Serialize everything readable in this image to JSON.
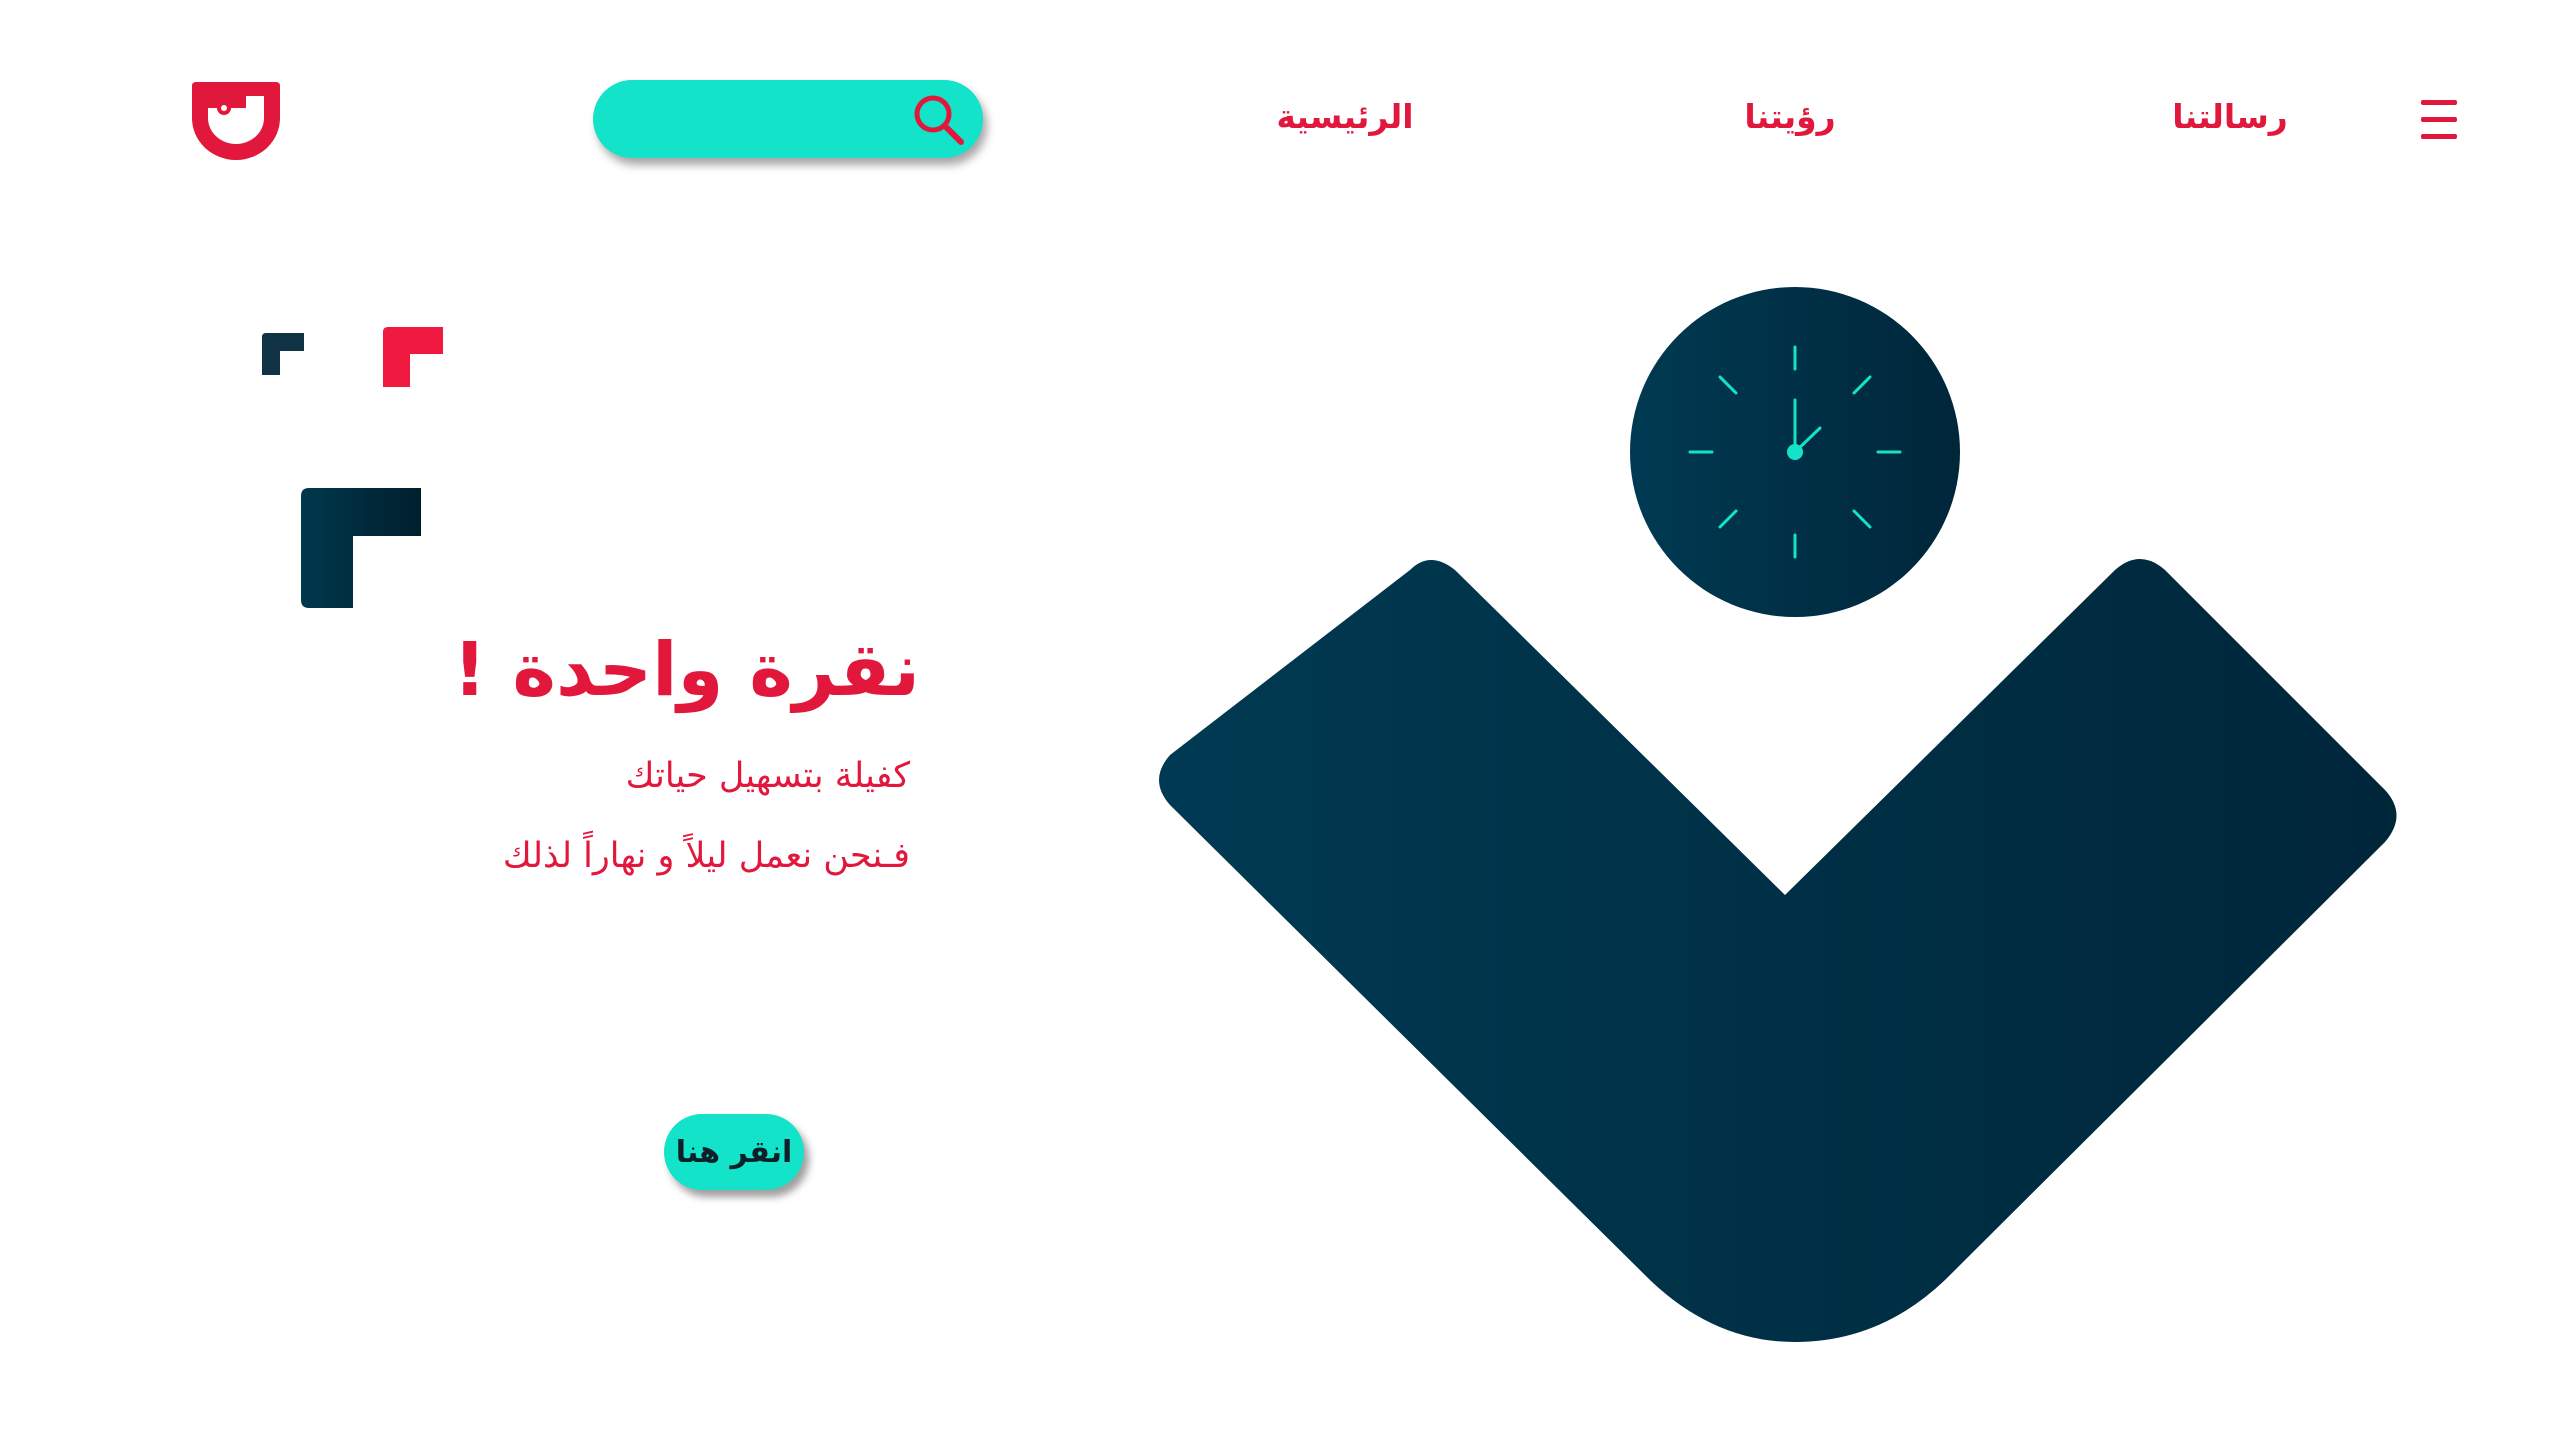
{
  "nav": {
    "home": "الرئيسية",
    "vision": "رؤيتنا",
    "mission": "رسالتنا"
  },
  "hero": {
    "title": "نقرة واحدة !",
    "line1": "كفيلة بتسهيل حياتك",
    "line2": "فـنحن نعمل ليلاً و نهاراً لذلك",
    "cta_label": "انقر هنا"
  },
  "colors": {
    "accent_red": "#e2173c",
    "accent_teal": "#13e3c8",
    "navy": "#003248",
    "background": "#ffffff"
  },
  "icons": {
    "logo": "smile-logo",
    "search": "search-icon",
    "menu": "hamburger-menu-icon",
    "clock": "clock-icon"
  }
}
